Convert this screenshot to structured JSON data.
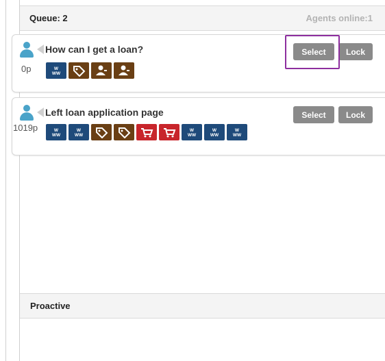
{
  "queue": {
    "title": "Queue: 2",
    "agents_online": "Agents online:1"
  },
  "chats": [
    {
      "title": "How can I get a loan?",
      "score": "0p",
      "icons": [
        "www-icon",
        "tag-icon",
        "visitor-icon",
        "visitor-icon"
      ],
      "select_label": "Select",
      "lock_label": "Lock"
    },
    {
      "title": "Left loan application page",
      "score": "1019p",
      "icons": [
        "www-icon",
        "www-icon",
        "tag-icon",
        "tag-icon",
        "cart-icon",
        "cart-icon",
        "www-icon",
        "www-icon",
        "www-icon"
      ],
      "select_label": "Select",
      "lock_label": "Lock"
    }
  ],
  "proactive": {
    "title": "Proactive"
  },
  "colors": {
    "www": "#1e4a7a",
    "tag": "#6a3f14",
    "cart": "#c8252b",
    "highlight": "#8d2e9e",
    "avatar": "#4aa3c9"
  }
}
